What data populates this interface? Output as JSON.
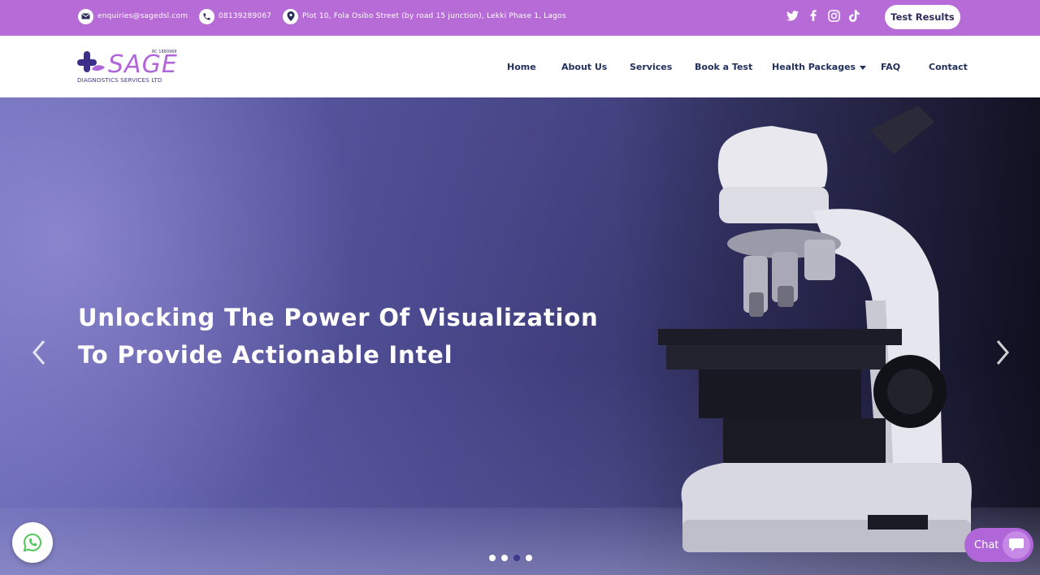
{
  "topbar": {
    "email": "enquiries@sagedsl.com",
    "phone": "08139289067",
    "address": "Plot 10, Fola Osibo Street (by road 15 junction), Lekki Phase 1, Lagos",
    "socials": [
      "twitter-icon",
      "facebook-icon",
      "instagram-icon",
      "tiktok-icon"
    ],
    "cta_label": "Test Results"
  },
  "logo": {
    "name": "SAGE",
    "rc": "RC 1880968",
    "subtitle": "DIAGNOSTICS SERVICES LTD"
  },
  "nav": {
    "items": [
      "Home",
      "About Us",
      "Services",
      "Book a Test",
      "Health Packages",
      "FAQ",
      "Contact"
    ]
  },
  "hero": {
    "headline_line1": "Unlocking The Power Of Visualization",
    "headline_line2": "To Provide Actionable Intel",
    "slide_count": 4,
    "active_slide": 3
  },
  "widgets": {
    "chat_label": "Chat"
  },
  "colors": {
    "brand_purple": "#b66bd6",
    "nav_text": "#22305c",
    "active_dot": "#3b3a8a"
  }
}
